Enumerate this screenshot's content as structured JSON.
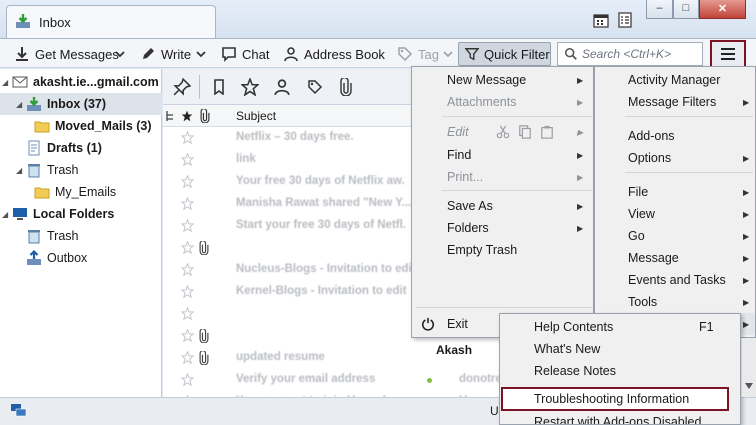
{
  "window": {
    "tab_title": "Inbox",
    "controls": {
      "minimize": "–",
      "maximize": "□",
      "close": "✕"
    }
  },
  "toolbar": {
    "get_messages": "Get Messages",
    "write": "Write",
    "chat": "Chat",
    "address_book": "Address Book",
    "tag": "Tag",
    "quick_filter": "Quick Filter",
    "search_placeholder": "Search <Ctrl+K>"
  },
  "folders": {
    "account": "akasht.ie...gmail.com",
    "inbox": "Inbox (37)",
    "moved_mails": "Moved_Mails (3)",
    "drafts": "Drafts (1)",
    "trash": "Trash",
    "my_emails": "My_Emails",
    "local_folders": "Local Folders",
    "local_trash": "Trash",
    "outbox": "Outbox"
  },
  "thread": {
    "subject_header": "Subject",
    "correspondent_visible": "Akash",
    "rows": [
      {
        "subject": "Netflix – 30 days free.",
        "clip": false,
        "dot": "",
        "corr": ""
      },
      {
        "subject": "link",
        "clip": false,
        "dot": "",
        "corr": ""
      },
      {
        "subject": "Your free 30 days of Netflix aw.",
        "clip": false,
        "dot": "",
        "corr": ""
      },
      {
        "subject": "Manisha Rawat shared \"New Y...",
        "clip": false,
        "dot": "",
        "corr": ""
      },
      {
        "subject": "Start your free 30 days of Netfl.",
        "clip": false,
        "dot": "",
        "corr": ""
      },
      {
        "subject": "",
        "clip": true,
        "dot": "",
        "corr": ""
      },
      {
        "subject": "Nucleus-Blogs - Invitation to edi",
        "clip": false,
        "dot": "",
        "corr": ""
      },
      {
        "subject": "Kernel-Blogs - Invitation to edit",
        "clip": false,
        "dot": "",
        "corr": ""
      },
      {
        "subject": "",
        "clip": false,
        "dot": "",
        "corr": ""
      },
      {
        "subject": "",
        "clip": true,
        "dot": "",
        "corr": ""
      },
      {
        "subject": "updated resume",
        "clip": true,
        "dot": "",
        "corr": ""
      },
      {
        "subject": "Verify your email address",
        "clip": false,
        "dot": "#7fbf3f",
        "corr": "donotre"
      },
      {
        "subject": "Your request to join Upwork",
        "clip": false,
        "dot": "#b0b0b0",
        "corr": "Upwo"
      }
    ]
  },
  "app_menu": {
    "col1": {
      "new_message": "New Message",
      "attachments": "Attachments",
      "edit": "Edit",
      "find": "Find",
      "print": "Print...",
      "save_as": "Save As",
      "folders": "Folders",
      "empty_trash": "Empty Trash",
      "exit": "Exit"
    },
    "col2": {
      "activity_manager": "Activity Manager",
      "message_filters": "Message Filters",
      "add_ons": "Add-ons",
      "options": "Options",
      "file": "File",
      "view": "View",
      "go": "Go",
      "message": "Message",
      "events_tasks": "Events and Tasks",
      "tools": "Tools"
    }
  },
  "help_menu": {
    "help_contents": "Help Contents",
    "help_shortcut": "F1",
    "whats_new": "What's New",
    "release_notes": "Release Notes",
    "troubleshooting": "Troubleshooting Information",
    "restart_addons": "Restart with Add-ons Disabled..."
  },
  "statusbar": {
    "partial": "U"
  },
  "colors": {
    "highlight_border": "#7a1424",
    "toolbar_bg": "#f3f5f8",
    "accent_green": "#2f9e3a"
  }
}
